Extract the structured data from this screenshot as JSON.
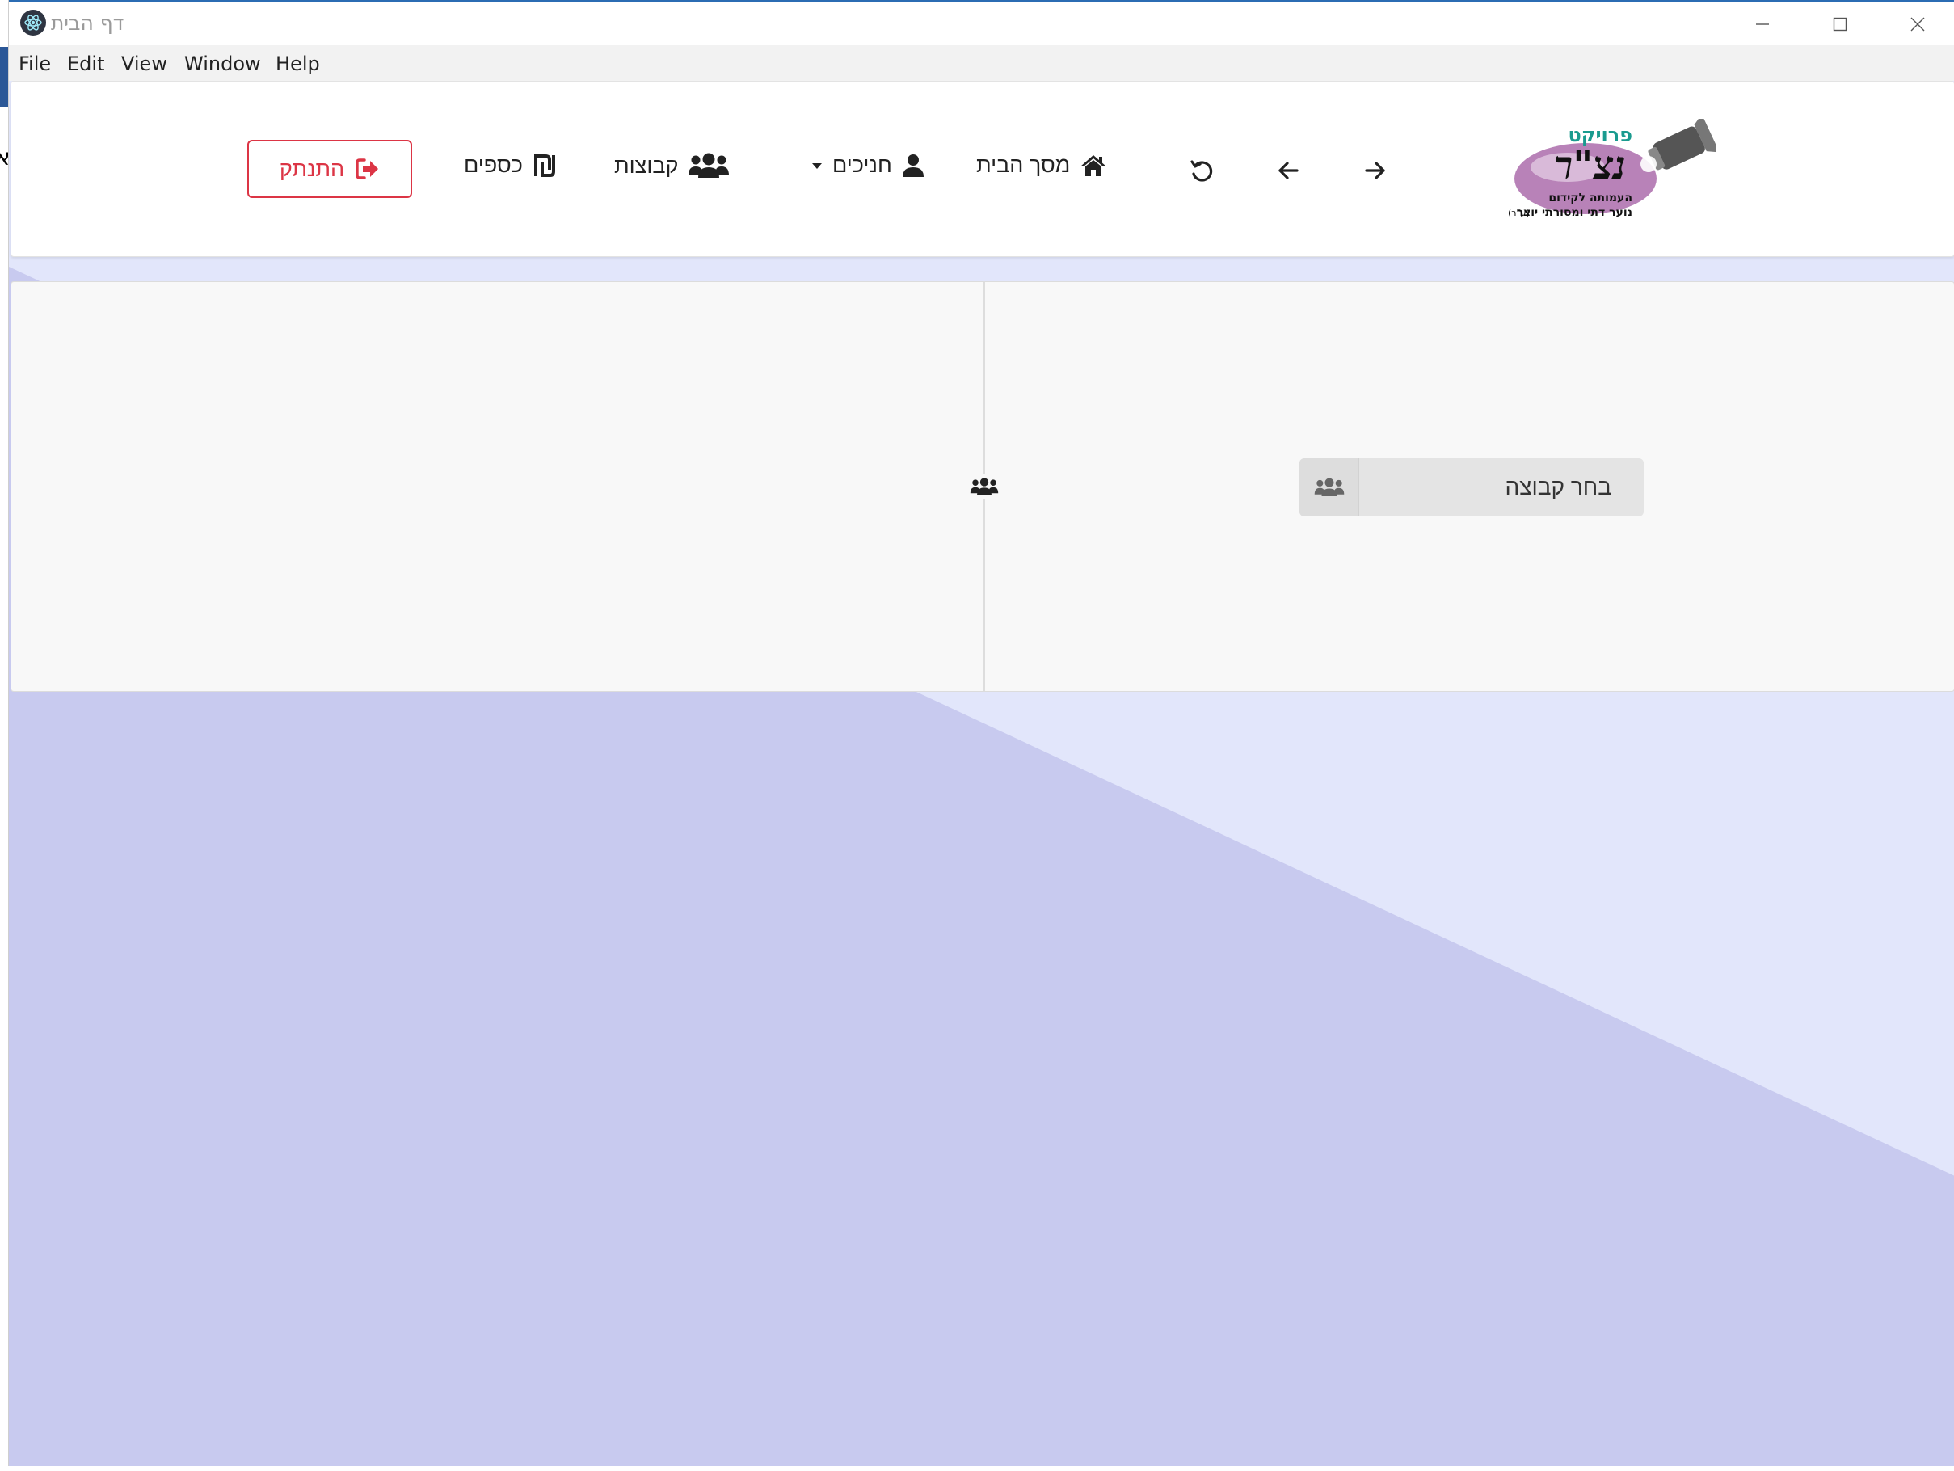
{
  "window": {
    "title": "דף הבית"
  },
  "menu": {
    "items": [
      "File",
      "Edit",
      "View",
      "Window",
      "Help"
    ]
  },
  "navbar": {
    "logo": {
      "line1": "פרויקט",
      "line2": "נצ\"ר",
      "line3": "העמותה לקידום",
      "line4": "נוער דתי ומסורתי יוצר",
      "line4_suffix": "(ע\"ר)"
    },
    "forward_icon": "arrow-right-icon",
    "back_icon": "arrow-left-icon",
    "refresh_icon": "undo-icon",
    "home_label": "מסך הבית",
    "trainees_label": "חניכים",
    "groups_label": "קבוצות",
    "money_label": "כספים",
    "logout_label": "התנתק"
  },
  "panel": {
    "group_select_label": "בחר קבוצה"
  },
  "colors": {
    "background_light": "#e2e6fb",
    "background_dark": "#c8caef",
    "logout_red": "#dc3545",
    "logo_teal": "#1a9b8f",
    "logo_purple": "#b882b8"
  }
}
